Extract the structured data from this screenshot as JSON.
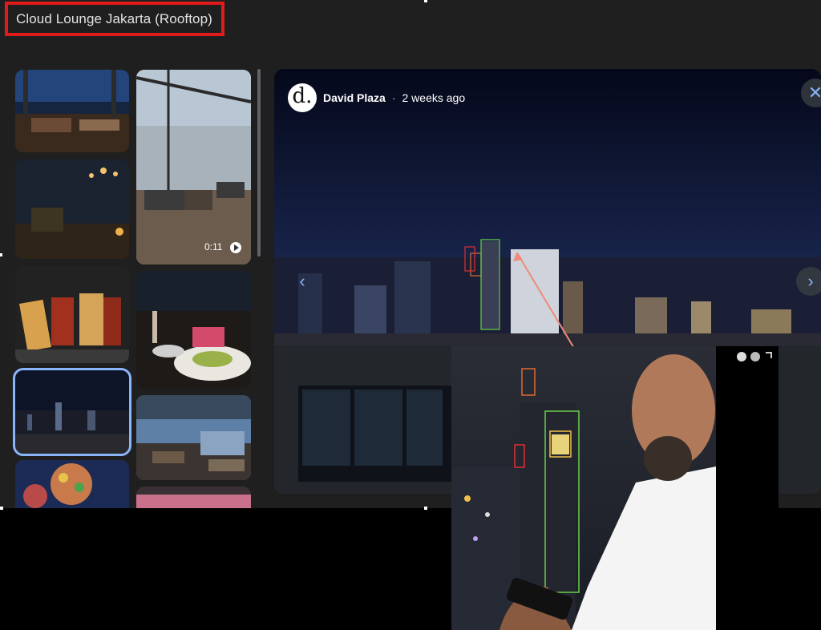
{
  "header": {
    "title": "Cloud Lounge Jakarta (Rooftop)"
  },
  "post": {
    "avatar_letter": "d.",
    "author": "David Plaza",
    "separator": "·",
    "time": "2 weeks ago"
  },
  "gallery": {
    "video_duration": "0:11",
    "items": [
      "rooftop-lounge-night-photo",
      "rooftop-terrace-day-video",
      "bar-interior-lights-photo",
      "sandwich-dish-photo",
      "restaurant-dinner-table-photo",
      "city-skyline-night-photo",
      "rooftop-terrace-pool-photo",
      "food-platter-photo",
      "rooftop-sunset-photo"
    ]
  },
  "overlay": {
    "zoom_icon": "zoom-icon",
    "expand_icon": "expand-icon"
  },
  "colors": {
    "panel_bg": "#1f1f1f",
    "accent": "#8ab4f8",
    "highlight_box": "#e01b1b"
  }
}
